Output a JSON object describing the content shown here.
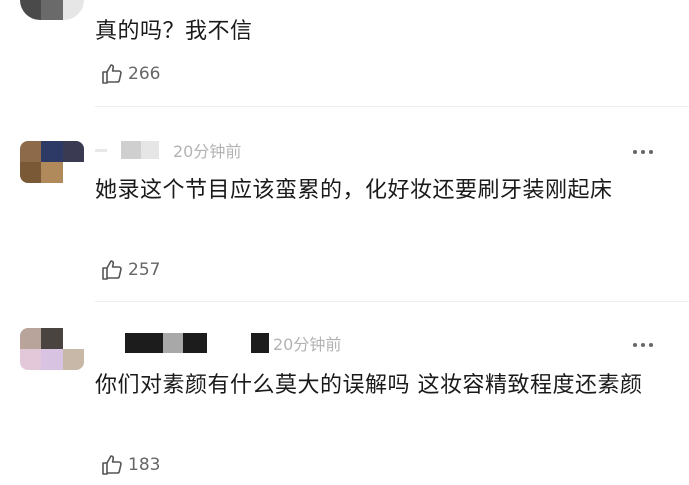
{
  "comments": [
    {
      "time": "",
      "text": "真的吗？我不信",
      "likes": "266",
      "avatar_colors": [
        "#d8d8d8",
        "#c9c9c9",
        "#d2d2d2",
        "#e2e2e2",
        "#e8e8e8",
        "#dcdcdc"
      ]
    },
    {
      "time": "20分钟前",
      "text": "她录这个节目应该蛮累的，化好妆还要刷牙装刚起床",
      "likes": "257",
      "avatar_colors": [
        "#8c6a4a",
        "#2d3a66",
        "#3a3a52",
        "#7a5a36",
        "#b08a5a",
        "#ffffff"
      ]
    },
    {
      "time": "20分钟前",
      "text": "你们对素颜有什么莫大的误解吗 这妆容精致程度还素颜",
      "likes": "183",
      "avatar_colors": [
        "#b8a49a",
        "#4a4440",
        "#ffffff",
        "#e2c8d8",
        "#d8c4e2",
        "#c8b8a8"
      ]
    }
  ],
  "icons": {
    "more": "more-dots-icon",
    "like": "thumbs-up-icon"
  },
  "colors": {
    "meta_gray": "#b3b3b3",
    "like_gray": "#666666",
    "divider": "#ececec"
  }
}
